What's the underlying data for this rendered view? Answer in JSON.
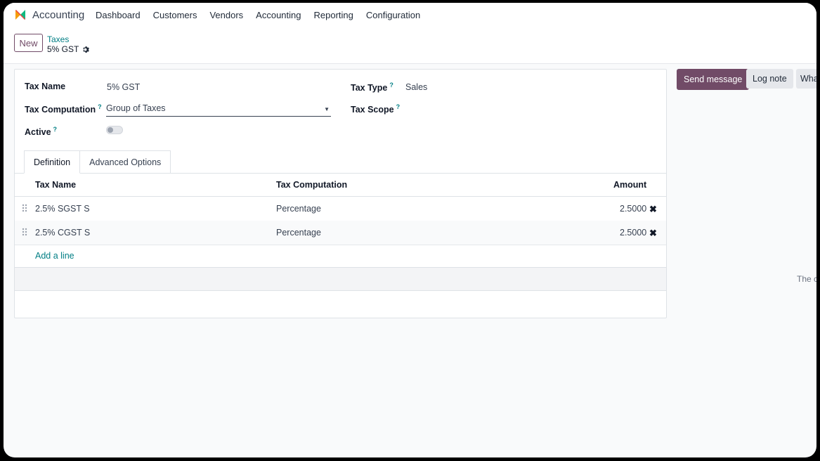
{
  "app": {
    "name": "Accounting",
    "logo_icon": "odoo-accounting-logo"
  },
  "menu": [
    "Dashboard",
    "Customers",
    "Vendors",
    "Accounting",
    "Reporting",
    "Configuration"
  ],
  "control": {
    "new_label": "New",
    "breadcrumb_parent": "Taxes",
    "breadcrumb_current": "5% GST"
  },
  "form": {
    "tax_name_label": "Tax Name",
    "tax_name_value": "5% GST",
    "tax_computation_label": "Tax Computation",
    "tax_computation_value": "Group of Taxes",
    "active_label": "Active",
    "active_value": false,
    "tax_type_label": "Tax Type",
    "tax_type_value": "Sales",
    "tax_scope_label": "Tax Scope",
    "help_mark": "?"
  },
  "tabs": [
    "Definition",
    "Advanced Options"
  ],
  "table": {
    "headers": {
      "name": "Tax Name",
      "computation": "Tax Computation",
      "amount": "Amount"
    },
    "rows": [
      {
        "name": "2.5% SGST S",
        "computation": "Percentage",
        "amount": "2.5000"
      },
      {
        "name": "2.5% CGST S",
        "computation": "Percentage",
        "amount": "2.5000"
      }
    ],
    "add_line": "Add a line",
    "delete_glyph": "✖"
  },
  "chatter": {
    "send_message": "Send message",
    "log_note": "Log note",
    "whatsapp": "Wha",
    "empty_text": "The c"
  },
  "colors": {
    "primary": "#714b67",
    "link": "#017e84"
  }
}
